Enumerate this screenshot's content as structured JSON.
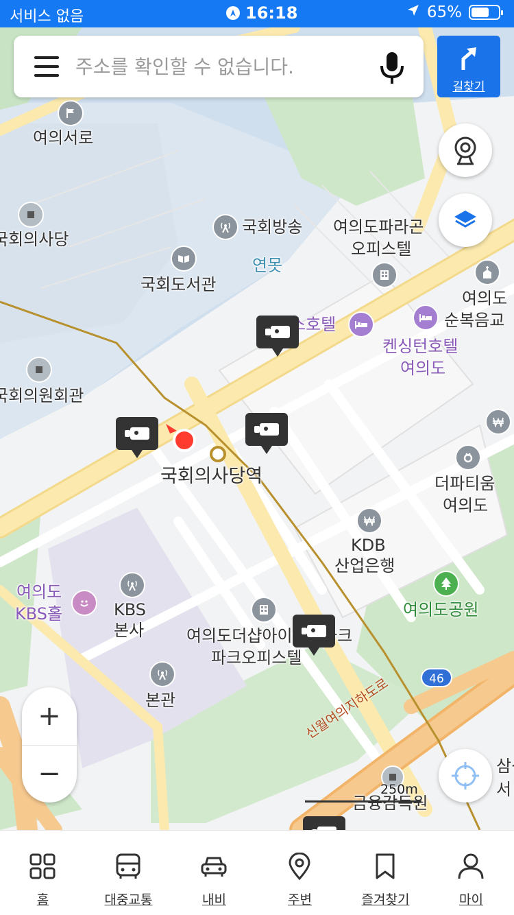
{
  "status_bar": {
    "carrier": "서비스 없음",
    "time": "16:18",
    "battery": "65%",
    "battery_level": 0.65
  },
  "search": {
    "placeholder": "주소를 확인할 수 없습니다.",
    "value": ""
  },
  "route_button": {
    "label": "길찾기"
  },
  "map": {
    "labels": {
      "yeouiseoro": "여의서로",
      "national_assembly": "국회의사당",
      "assembly_broadcast": "국회방송",
      "assembly_library": "국회도서관",
      "pond": "연못",
      "parago_1": "여의도파라곤",
      "parago_2": "오피스텔",
      "yeouido_1": "여의도",
      "gospel_church": "순복음교",
      "hotel_partial": "스호텔",
      "kensington_1": "켄싱턴호텔",
      "kensington_2": "여의도",
      "assembly_members_hall": "국회의원회관",
      "station": "국회의사당역",
      "the_pati_1": "더파티움",
      "the_pati_2": "여의도",
      "kdb_1": "KDB",
      "kdb_2": "산업은행",
      "kbs_hall_1": "여의도",
      "kbs_hall_2": "KBS홀",
      "kbs_hq_1": "KBS",
      "kbs_hq_2": "본사",
      "yeouido_park": "여의도공원",
      "theshop_1": "여의도더샵아이",
      "theshop_suffix": "파크",
      "theshop_2": "파크오피스텔",
      "main_hall": "본관",
      "road_46": "46",
      "underpass": "신월여의지하도로",
      "fss": "금융감독원",
      "samsung_1": "삼성",
      "samsung_2": "서"
    },
    "scale": "250m"
  },
  "zoom": {
    "in": "+",
    "out": "−"
  },
  "bottom_nav": [
    {
      "label": "홈",
      "icon": "grid-icon"
    },
    {
      "label": "대중교통",
      "icon": "bus-icon"
    },
    {
      "label": "내비",
      "icon": "car-icon"
    },
    {
      "label": "주변",
      "icon": "location-pin-icon"
    },
    {
      "label": "즐겨찾기",
      "icon": "bookmark-icon"
    },
    {
      "label": "마이",
      "icon": "person-icon"
    }
  ]
}
